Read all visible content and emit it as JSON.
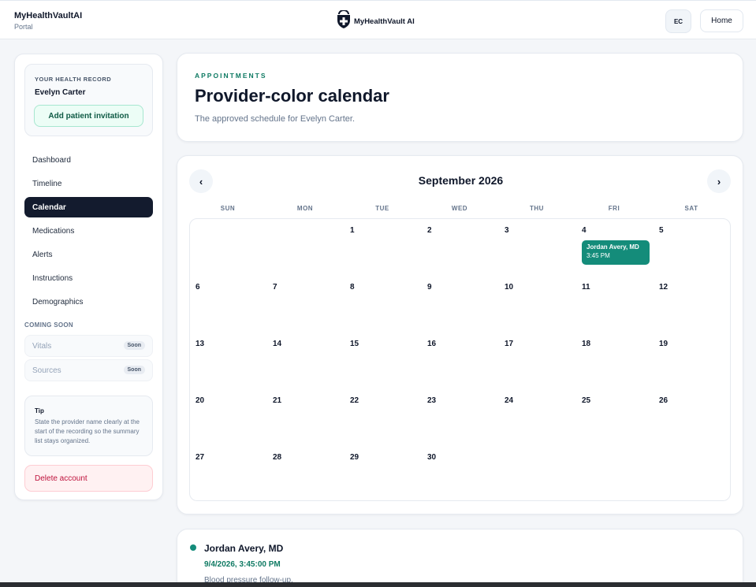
{
  "header": {
    "brand_title": "MyHealthVaultAI",
    "brand_subtitle": "Portal",
    "logo_text": "MyHealthVault AI",
    "avatar_initials": "EC",
    "home_label": "Home"
  },
  "sidebar": {
    "record_label": "YOUR HEALTH RECORD",
    "patient_name": "Evelyn Carter",
    "invite_label": "Add patient invitation",
    "nav_items": [
      {
        "label": "Dashboard",
        "active": false
      },
      {
        "label": "Timeline",
        "active": false
      },
      {
        "label": "Calendar",
        "active": true
      },
      {
        "label": "Medications",
        "active": false
      },
      {
        "label": "Alerts",
        "active": false
      },
      {
        "label": "Instructions",
        "active": false
      },
      {
        "label": "Demographics",
        "active": false
      }
    ],
    "coming_soon_label": "COMING SOON",
    "coming_soon_items": [
      {
        "label": "Vitals",
        "badge": "Soon"
      },
      {
        "label": "Sources",
        "badge": "Soon"
      }
    ],
    "tip": {
      "title": "Tip",
      "text": "State the provider name clearly at the start of the recording so the summary list stays organized."
    },
    "delete_label": "Delete account"
  },
  "page": {
    "eyebrow": "APPOINTMENTS",
    "title": "Provider-color calendar",
    "subtitle": "The approved schedule for Evelyn Carter."
  },
  "calendar": {
    "month_title": "September 2026",
    "prev_icon": "chevron-left-icon",
    "next_icon": "chevron-right-icon",
    "days_of_week": [
      "SUN",
      "MON",
      "TUE",
      "WED",
      "THU",
      "FRI",
      "SAT"
    ],
    "weeks": [
      [
        "",
        "",
        "1",
        "2",
        "3",
        "4",
        "5"
      ],
      [
        "6",
        "7",
        "8",
        "9",
        "10",
        "11",
        "12"
      ],
      [
        "13",
        "14",
        "15",
        "16",
        "17",
        "18",
        "19"
      ],
      [
        "20",
        "21",
        "22",
        "23",
        "24",
        "25",
        "26"
      ],
      [
        "27",
        "28",
        "29",
        "30",
        "",
        "",
        ""
      ]
    ],
    "events": [
      {
        "day": "4",
        "provider": "Jordan Avery, MD",
        "time": "3:45 PM",
        "color": "#148c7a"
      }
    ]
  },
  "appointment_detail": {
    "provider": "Jordan Avery, MD",
    "datetime": "9/4/2026, 3:45:00 PM",
    "note": "Blood pressure follow-up.",
    "dot_color": "#148c7a"
  },
  "colors": {
    "accent": "#0f7a63",
    "active_nav": "#131b2e",
    "danger": "#be123c"
  }
}
